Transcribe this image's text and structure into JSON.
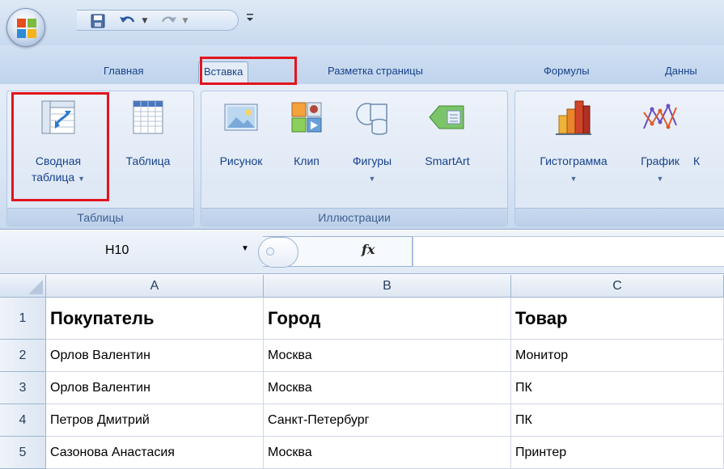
{
  "quick_access": {
    "save_icon": "save-icon",
    "undo_icon": "undo-icon",
    "redo_icon": "redo-icon",
    "customize_icon": "customize-qat-icon"
  },
  "tabs": [
    {
      "label": "Главная"
    },
    {
      "label": "Вставка",
      "active": true
    },
    {
      "label": "Разметка страницы"
    },
    {
      "label": "Формулы"
    },
    {
      "label": "Данны"
    }
  ],
  "ribbon": {
    "groups": [
      {
        "label": "Таблицы",
        "buttons": [
          {
            "label_line1": "Сводная",
            "label_line2": "таблица",
            "icon": "pivot-table-icon",
            "highlighted": true
          },
          {
            "label_line1": "Таблица",
            "icon": "table-icon"
          }
        ]
      },
      {
        "label": "Иллюстрации",
        "buttons": [
          {
            "label_line1": "Рисунок",
            "icon": "picture-icon"
          },
          {
            "label_line1": "Клип",
            "icon": "clip-art-icon"
          },
          {
            "label_line1": "Фигуры",
            "icon": "shapes-icon"
          },
          {
            "label_line1": "SmartArt",
            "icon": "smartart-icon"
          }
        ]
      },
      {
        "label": "",
        "buttons": [
          {
            "label_line1": "Гистограмма",
            "icon": "column-chart-icon"
          },
          {
            "label_line1": "График",
            "icon": "line-chart-icon"
          },
          {
            "label_line1": "К",
            "icon": ""
          }
        ]
      }
    ]
  },
  "formula_bar": {
    "name_box": "H10",
    "fx_label": "fx",
    "formula": ""
  },
  "sheet": {
    "columns": [
      "A",
      "B",
      "C"
    ],
    "rows": [
      {
        "num": "1",
        "cells": [
          "Покупатель",
          "Город",
          "Товар"
        ]
      },
      {
        "num": "2",
        "cells": [
          "Орлов Валентин",
          "Москва",
          "Монитор"
        ]
      },
      {
        "num": "3",
        "cells": [
          "Орлов Валентин",
          "Москва",
          "ПК"
        ]
      },
      {
        "num": "4",
        "cells": [
          "Петров Дмитрий",
          "Санкт-Петербург",
          "ПК"
        ]
      },
      {
        "num": "5",
        "cells": [
          "Сазонова Анастасия",
          "Москва",
          "Принтер"
        ]
      }
    ]
  },
  "colors": {
    "highlight_red": "#e3141d",
    "ribbon_blue": "#15428b"
  }
}
